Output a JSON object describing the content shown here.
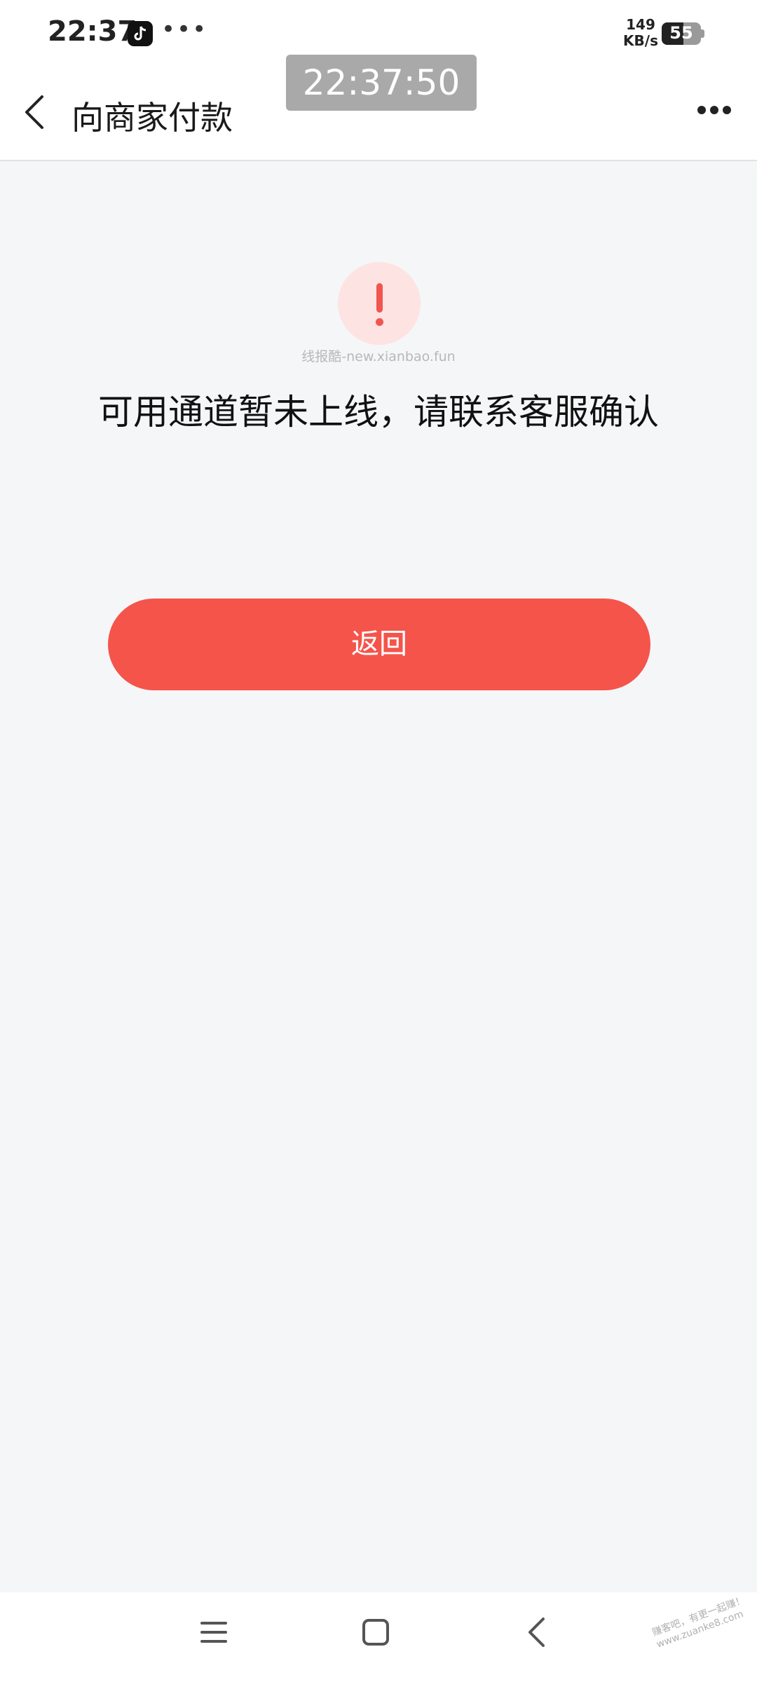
{
  "status_bar": {
    "time": "22:37",
    "dots": "•••",
    "net_speed_value": "149",
    "net_speed_unit": "KB/s",
    "battery": "55",
    "battery_level_percent": 55
  },
  "overlay": {
    "clock": "22:37:50"
  },
  "header": {
    "title": "向商家付款"
  },
  "main": {
    "watermark": "线报酷-new.xianbao.fun",
    "message": "可用通道暂未上线，请联系客服确认",
    "return_button_label": "返回"
  },
  "watermark_bottom": {
    "line1": "赚客吧，有更一起赚！",
    "line2": "www.zuanke8.com"
  },
  "colors": {
    "accent": "#f5544b",
    "alert_bg": "#fde3e1",
    "page_bg": "#f5f6f8"
  },
  "icons": {
    "back": "chevron-left-icon",
    "more": "more-horizontal-icon",
    "alert": "exclamation-icon",
    "app": "tiktok-icon"
  }
}
